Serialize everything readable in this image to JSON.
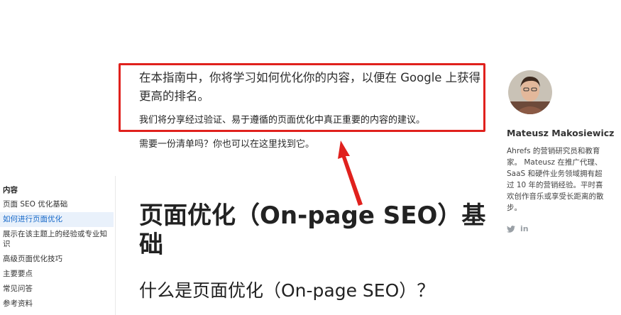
{
  "article": {
    "intro_main": "在本指南中，你将学习如何优化你的内容，以便在 Google 上获得更高的排名。",
    "intro_sub": "我们将分享经过验证、易于遵循的页面优化中真正重要的内容的建议。",
    "checklist_text": "需要一份清单吗？你也可以在这里找到它。",
    "h1": "页面优化（On-page SEO）基础",
    "h2": "什么是页面优化（On-page SEO）？"
  },
  "toc": {
    "title": "内容",
    "items": [
      {
        "label": "页面 SEO 优化基础",
        "active": false
      },
      {
        "label": "如何进行页面优化",
        "active": true
      },
      {
        "label": "展示在该主题上的经验或专业知识",
        "active": false
      },
      {
        "label": "高级页面优化技巧",
        "active": false
      },
      {
        "label": "主要要点",
        "active": false
      },
      {
        "label": "常见问答",
        "active": false
      },
      {
        "label": "参考资料",
        "active": false
      }
    ]
  },
  "author": {
    "name": "Mateusz Makosiewicz",
    "bio": "Ahrefs 的营销研究员和教育家。 Mateusz 在推广代理、SaaS 和硬件业务领域拥有超过 10 年的营销经验。平时喜欢创作音乐或享受长距离的散步。",
    "social": [
      "twitter-icon",
      "linkedin-icon"
    ],
    "social_labels": {
      "linkedin": "in"
    }
  },
  "annotation": {
    "box_color": "#e0211d",
    "arrow_color": "#e0211d"
  },
  "colors": {
    "toc_active_bg": "#e9f1fb",
    "toc_active_text": "#1467c8"
  }
}
